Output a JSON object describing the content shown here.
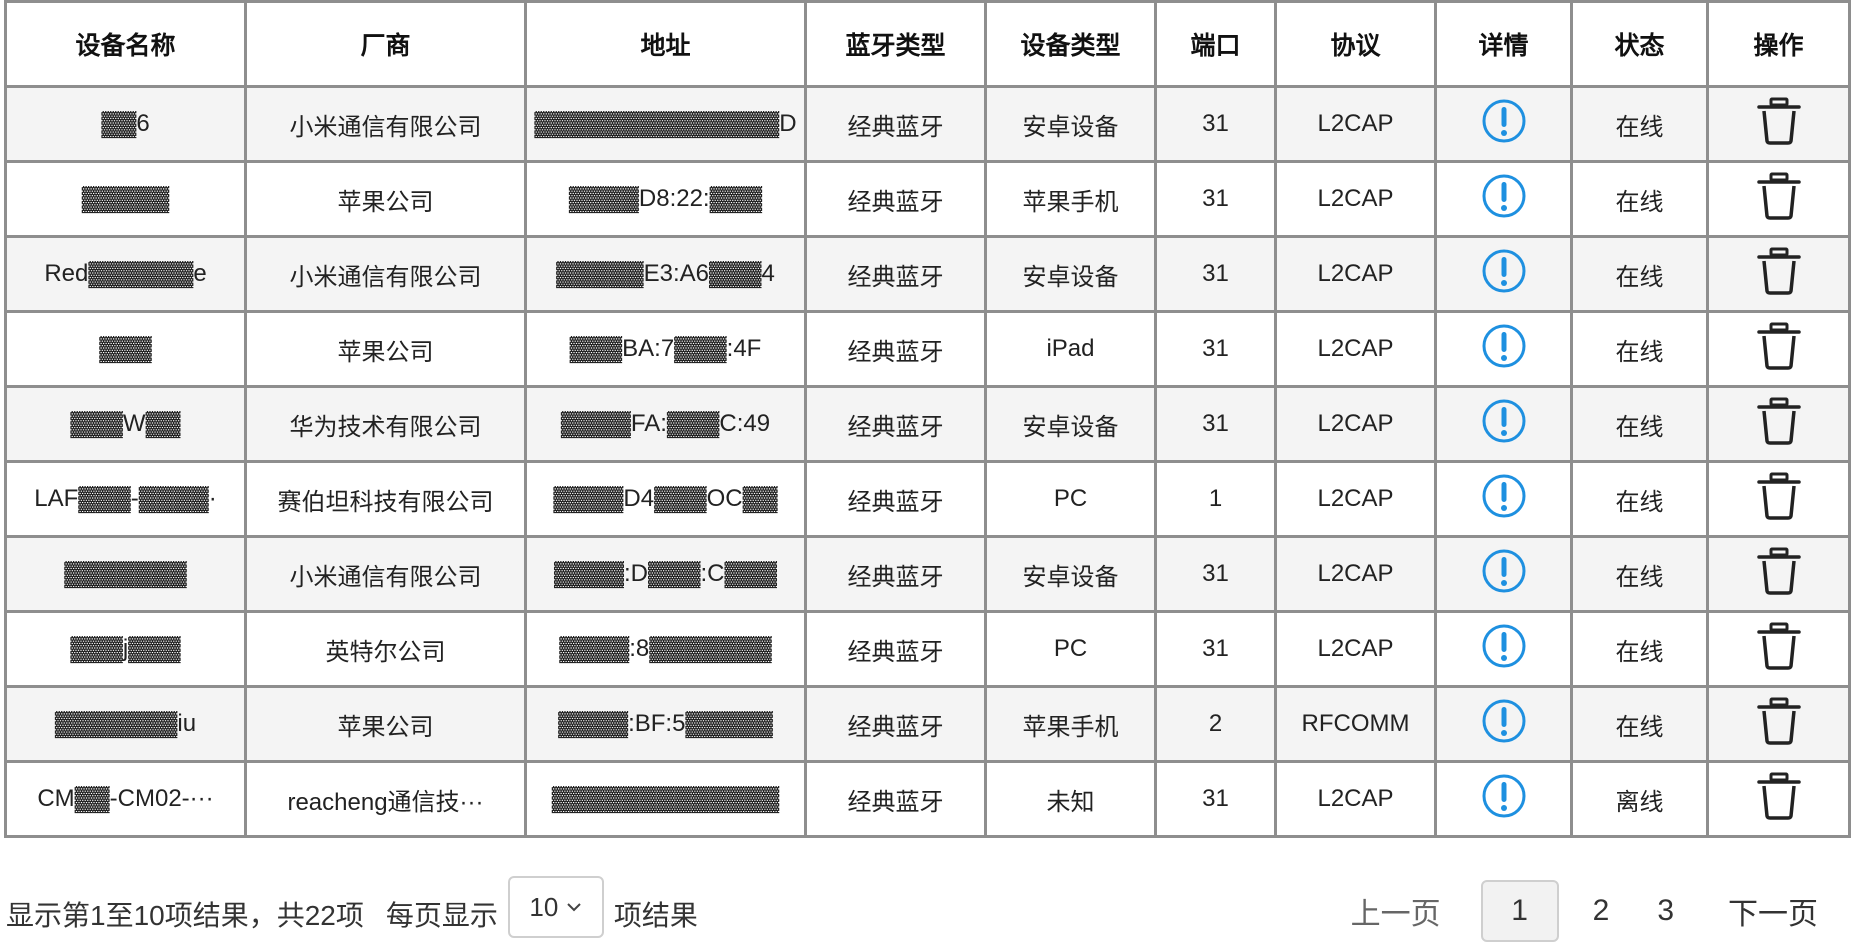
{
  "table": {
    "headers": [
      "设备名称",
      "厂商",
      "地址",
      "蓝牙类型",
      "设备类型",
      "端口",
      "协议",
      "详情",
      "状态",
      "操作"
    ],
    "rows": [
      {
        "name": "▓▓6",
        "vendor": "小米通信有限公司",
        "address": "▓▓▓▓▓▓▓▓▓▓▓▓▓▓D",
        "bt_type": "经典蓝牙",
        "device_type": "安卓设备",
        "port": "31",
        "protocol": "L2CAP",
        "status": "在线"
      },
      {
        "name": "▓▓▓▓▓",
        "vendor": "苹果公司",
        "address": "▓▓▓▓D8:22:▓▓▓",
        "bt_type": "经典蓝牙",
        "device_type": "苹果手机",
        "port": "31",
        "protocol": "L2CAP",
        "status": "在线"
      },
      {
        "name": "Red▓▓▓▓▓▓e",
        "vendor": "小米通信有限公司",
        "address": "▓▓▓▓▓E3:A6▓▓▓4",
        "bt_type": "经典蓝牙",
        "device_type": "安卓设备",
        "port": "31",
        "protocol": "L2CAP",
        "status": "在线"
      },
      {
        "name": "▓▓▓",
        "vendor": "苹果公司",
        "address": "▓▓▓BA:7▓▓▓:4F",
        "bt_type": "经典蓝牙",
        "device_type": "iPad",
        "port": "31",
        "protocol": "L2CAP",
        "status": "在线"
      },
      {
        "name": "▓▓▓W▓▓",
        "vendor": "华为技术有限公司",
        "address": "▓▓▓▓FA:▓▓▓C:49",
        "bt_type": "经典蓝牙",
        "device_type": "安卓设备",
        "port": "31",
        "protocol": "L2CAP",
        "status": "在线"
      },
      {
        "name": "LAF▓▓▓-▓▓▓▓·",
        "vendor": "赛伯坦科技有限公司",
        "address": "▓▓▓▓D4▓▓▓OC▓▓",
        "bt_type": "经典蓝牙",
        "device_type": "PC",
        "port": "1",
        "protocol": "L2CAP",
        "status": "在线"
      },
      {
        "name": "▓▓▓▓▓▓▓",
        "vendor": "小米通信有限公司",
        "address": "▓▓▓▓:D▓▓▓:C▓▓▓",
        "bt_type": "经典蓝牙",
        "device_type": "安卓设备",
        "port": "31",
        "protocol": "L2CAP",
        "status": "在线"
      },
      {
        "name": "▓▓▓j▓▓▓",
        "vendor": "英特尔公司",
        "address": "▓▓▓▓:8▓▓▓▓▓▓▓",
        "bt_type": "经典蓝牙",
        "device_type": "PC",
        "port": "31",
        "protocol": "L2CAP",
        "status": "在线"
      },
      {
        "name": "▓▓▓▓▓▓▓iu",
        "vendor": "苹果公司",
        "address": "▓▓▓▓:BF:5▓▓▓▓▓",
        "bt_type": "经典蓝牙",
        "device_type": "苹果手机",
        "port": "2",
        "protocol": "RFCOMM",
        "status": "在线"
      },
      {
        "name": "CM▓▓-CM02-···",
        "vendor": "reacheng通信技···",
        "address": "▓▓▓▓▓▓▓▓▓▓▓▓▓",
        "bt_type": "经典蓝牙",
        "device_type": "未知",
        "port": "31",
        "protocol": "L2CAP",
        "status": "离线"
      }
    ]
  },
  "footer": {
    "summary_prefix": "显示第1至10项结果，共22项",
    "per_page_label": "每页显示",
    "per_page_value": "10",
    "per_page_suffix": "项结果",
    "prev_label": "上一页",
    "next_label": "下一页",
    "pages": [
      "1",
      "2",
      "3"
    ],
    "active_page": "1"
  },
  "icons": {
    "detail": "info-circle-icon",
    "delete": "trash-icon",
    "dropdown": "chevron-down-icon"
  },
  "colors": {
    "info_icon": "#1e90e0",
    "border": "#8e8e8e",
    "row_stripe": "#f4f4f4"
  }
}
